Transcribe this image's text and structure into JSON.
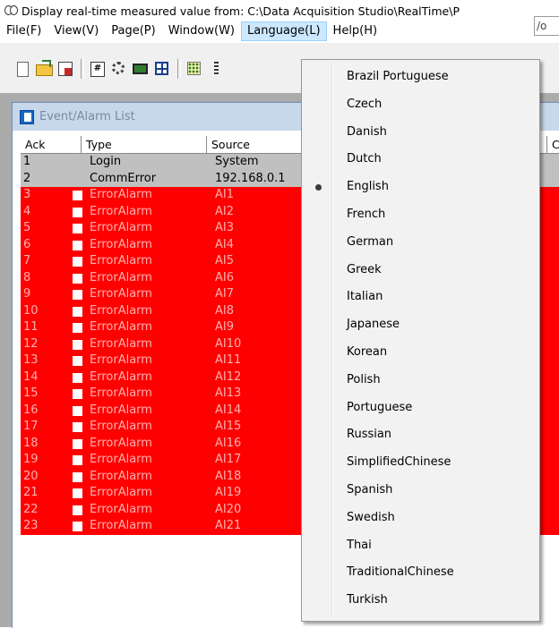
{
  "window": {
    "title": "Display real-time measured value from: C:\\Data Acquisition Studio\\RealTime\\P"
  },
  "menubar": {
    "items": [
      {
        "label": "File(F)",
        "name": "menu-file"
      },
      {
        "label": "View(V)",
        "name": "menu-view"
      },
      {
        "label": "Page(P)",
        "name": "menu-page"
      },
      {
        "label": "Window(W)",
        "name": "menu-window"
      },
      {
        "label": "Language(L)",
        "name": "menu-language",
        "active": true
      },
      {
        "label": "Help(H)",
        "name": "menu-help"
      }
    ]
  },
  "toolbar": {
    "buttons": [
      "new-file-icon",
      "open-folder-icon",
      "save-as-icon",
      "calculator-icon",
      "settings-gear-icon",
      "monitor-icon",
      "layout-grid-icon",
      "dot-matrix-icon",
      "bar-icon"
    ],
    "field_text": "/o"
  },
  "child_window": {
    "title": "Event/Alarm List"
  },
  "table": {
    "columns": [
      {
        "key": "ack",
        "label": "Ack"
      },
      {
        "key": "type",
        "label": "Type"
      },
      {
        "key": "source",
        "label": "Source"
      },
      {
        "key": "extra",
        "label": "C"
      }
    ],
    "rows": [
      {
        "ack": "1",
        "type": "Login",
        "source": "System",
        "status": "normal",
        "checkbox": false
      },
      {
        "ack": "2",
        "type": "CommError",
        "source": "192.168.0.1",
        "status": "normal",
        "checkbox": false
      },
      {
        "ack": "3",
        "type": "ErrorAlarm",
        "source": "AI1",
        "status": "alarm",
        "checkbox": true
      },
      {
        "ack": "4",
        "type": "ErrorAlarm",
        "source": "AI2",
        "status": "alarm",
        "checkbox": true
      },
      {
        "ack": "5",
        "type": "ErrorAlarm",
        "source": "AI3",
        "status": "alarm",
        "checkbox": true
      },
      {
        "ack": "6",
        "type": "ErrorAlarm",
        "source": "AI4",
        "status": "alarm",
        "checkbox": true
      },
      {
        "ack": "7",
        "type": "ErrorAlarm",
        "source": "AI5",
        "status": "alarm",
        "checkbox": true
      },
      {
        "ack": "8",
        "type": "ErrorAlarm",
        "source": "AI6",
        "status": "alarm",
        "checkbox": true
      },
      {
        "ack": "9",
        "type": "ErrorAlarm",
        "source": "AI7",
        "status": "alarm",
        "checkbox": true
      },
      {
        "ack": "10",
        "type": "ErrorAlarm",
        "source": "AI8",
        "status": "alarm",
        "checkbox": true
      },
      {
        "ack": "11",
        "type": "ErrorAlarm",
        "source": "AI9",
        "status": "alarm",
        "checkbox": true
      },
      {
        "ack": "12",
        "type": "ErrorAlarm",
        "source": "AI10",
        "status": "alarm",
        "checkbox": true
      },
      {
        "ack": "13",
        "type": "ErrorAlarm",
        "source": "AI11",
        "status": "alarm",
        "checkbox": true
      },
      {
        "ack": "14",
        "type": "ErrorAlarm",
        "source": "AI12",
        "status": "alarm",
        "checkbox": true
      },
      {
        "ack": "15",
        "type": "ErrorAlarm",
        "source": "AI13",
        "status": "alarm",
        "checkbox": true
      },
      {
        "ack": "16",
        "type": "ErrorAlarm",
        "source": "AI14",
        "status": "alarm",
        "checkbox": true
      },
      {
        "ack": "17",
        "type": "ErrorAlarm",
        "source": "AI15",
        "status": "alarm",
        "checkbox": true
      },
      {
        "ack": "18",
        "type": "ErrorAlarm",
        "source": "AI16",
        "status": "alarm",
        "checkbox": true
      },
      {
        "ack": "19",
        "type": "ErrorAlarm",
        "source": "AI17",
        "status": "alarm",
        "checkbox": true
      },
      {
        "ack": "20",
        "type": "ErrorAlarm",
        "source": "AI18",
        "status": "alarm",
        "checkbox": true
      },
      {
        "ack": "21",
        "type": "ErrorAlarm",
        "source": "AI19",
        "status": "alarm",
        "checkbox": true
      },
      {
        "ack": "22",
        "type": "ErrorAlarm",
        "source": "AI20",
        "status": "alarm",
        "checkbox": true
      },
      {
        "ack": "23",
        "type": "ErrorAlarm",
        "source": "AI21",
        "status": "alarm",
        "checkbox": true
      }
    ]
  },
  "language_menu": {
    "selected": "English",
    "items": [
      "Brazil Portuguese",
      "Czech",
      "Danish",
      "Dutch",
      "English",
      "French",
      "German",
      "Greek",
      "Italian",
      "Japanese",
      "Korean",
      "Polish",
      "Portuguese",
      "Russian",
      "SimplifiedChinese",
      "Spanish",
      "Swedish",
      "Thai",
      "TraditionalChinese",
      "Turkish"
    ]
  },
  "colors": {
    "alarm_row": "#ff0000",
    "normal_row": "#c0c0c0",
    "menu_highlight": "#cce8ff"
  }
}
